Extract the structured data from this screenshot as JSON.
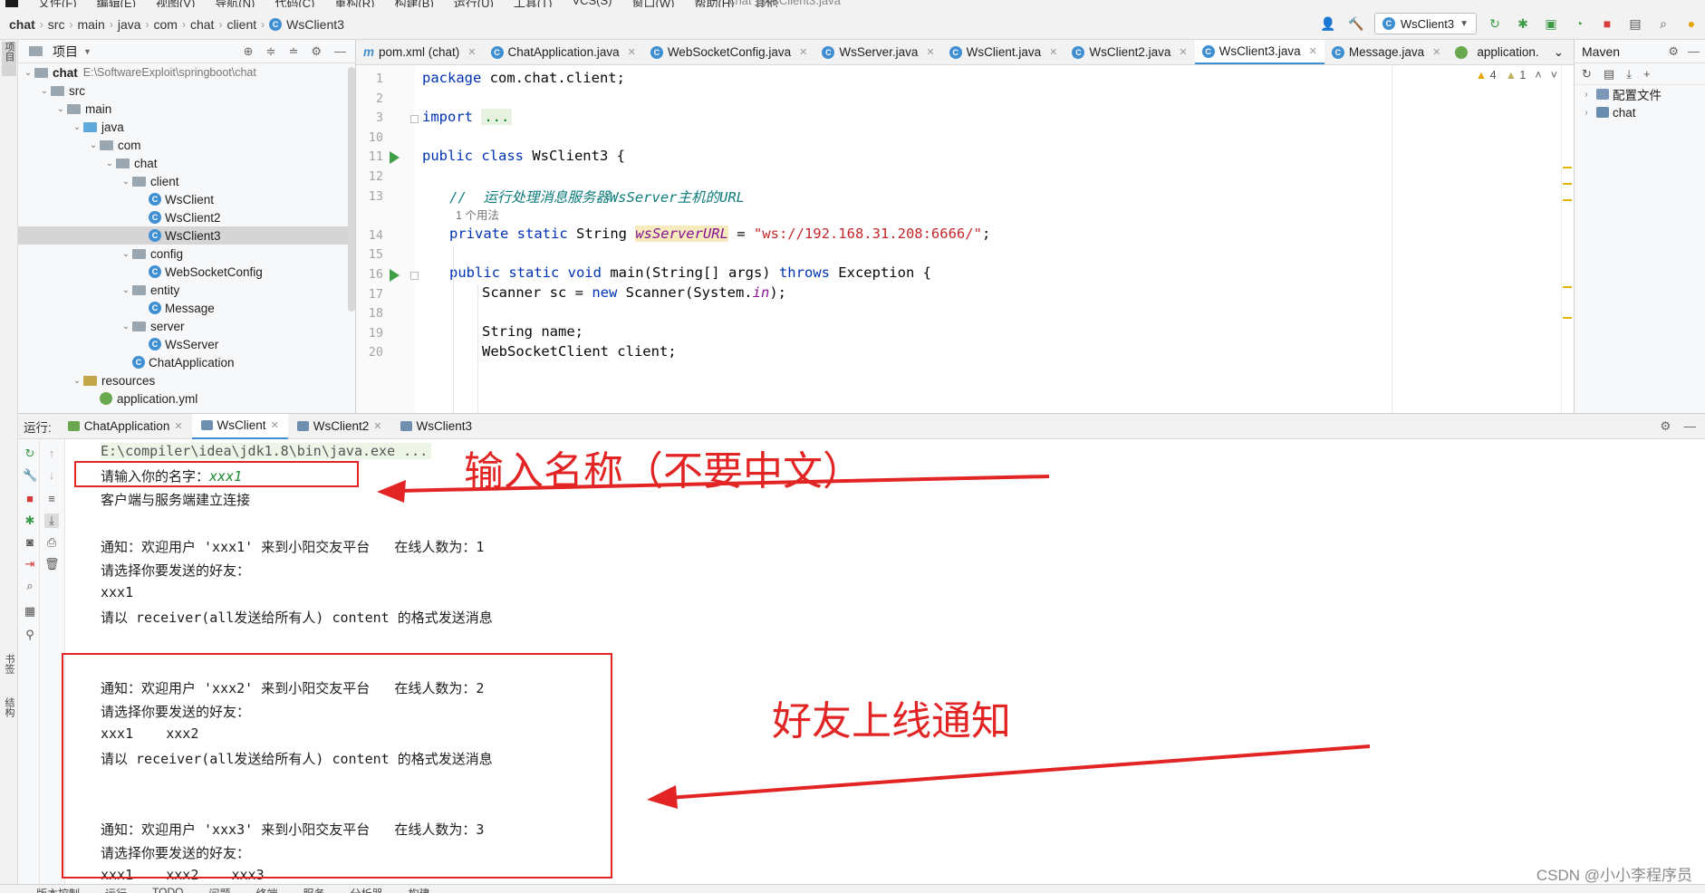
{
  "menubar": {
    "items": [
      "文件(F)",
      "编辑(E)",
      "视图(V)",
      "导航(N)",
      "代码(C)",
      "重构(R)",
      "构建(B)",
      "运行(U)",
      "工具(T)",
      "VCS(S)",
      "窗口(W)",
      "帮助(H)",
      "其他"
    ],
    "window_title": "chat - WsClient3.java"
  },
  "breadcrumb": [
    "chat",
    "src",
    "main",
    "java",
    "com",
    "chat",
    "client",
    "WsClient3"
  ],
  "toolbar": {
    "run_config": "WsClient3"
  },
  "left_strip": {
    "project_label": "项目",
    "bookmarks_label": "书签",
    "structure_label": "结构"
  },
  "project": {
    "title": "项目",
    "tree": [
      {
        "label": "chat",
        "extra": "E:\\SoftwareExploit\\springboot\\chat",
        "depth": 0,
        "type": "module",
        "open": true
      },
      {
        "label": "src",
        "depth": 1,
        "type": "folder",
        "open": true
      },
      {
        "label": "main",
        "depth": 2,
        "type": "folder",
        "open": true
      },
      {
        "label": "java",
        "depth": 3,
        "type": "folder-blue",
        "open": true
      },
      {
        "label": "com",
        "depth": 4,
        "type": "folder",
        "open": true
      },
      {
        "label": "chat",
        "depth": 5,
        "type": "folder",
        "open": true
      },
      {
        "label": "client",
        "depth": 6,
        "type": "folder",
        "open": true
      },
      {
        "label": "WsClient",
        "depth": 7,
        "type": "class"
      },
      {
        "label": "WsClient2",
        "depth": 7,
        "type": "class"
      },
      {
        "label": "WsClient3",
        "depth": 7,
        "type": "class",
        "selected": true
      },
      {
        "label": "config",
        "depth": 6,
        "type": "folder",
        "open": true
      },
      {
        "label": "WebSocketConfig",
        "depth": 7,
        "type": "class"
      },
      {
        "label": "entity",
        "depth": 6,
        "type": "folder",
        "open": true
      },
      {
        "label": "Message",
        "depth": 7,
        "type": "class"
      },
      {
        "label": "server",
        "depth": 6,
        "type": "folder",
        "open": true
      },
      {
        "label": "WsServer",
        "depth": 7,
        "type": "class"
      },
      {
        "label": "ChatApplication",
        "depth": 6,
        "type": "class"
      },
      {
        "label": "resources",
        "depth": 3,
        "type": "folder-res",
        "open": true
      },
      {
        "label": "application.yml",
        "depth": 4,
        "type": "yml"
      }
    ]
  },
  "editor": {
    "tabs": [
      {
        "label": "pom.xml (chat)",
        "icon": "m"
      },
      {
        "label": "ChatApplication.java",
        "icon": "c"
      },
      {
        "label": "WebSocketConfig.java",
        "icon": "c"
      },
      {
        "label": "WsServer.java",
        "icon": "c"
      },
      {
        "label": "WsClient.java",
        "icon": "c"
      },
      {
        "label": "WsClient2.java",
        "icon": "c"
      },
      {
        "label": "WsClient3.java",
        "icon": "c",
        "active": true
      },
      {
        "label": "Message.java",
        "icon": "c"
      },
      {
        "label": "application.",
        "icon": "yml"
      }
    ],
    "inspections": {
      "warnings": "4",
      "weak_warnings": "1"
    },
    "line_numbers": [
      "1",
      "2",
      "3",
      "10",
      "11",
      "12",
      "13",
      "",
      "14",
      "15",
      "16",
      "17",
      "18",
      "19",
      "20"
    ],
    "code": {
      "l1_kw": "package",
      "l1_rest": " com.chat.client;",
      "l3_kw": "import",
      "l3_fold": "...",
      "l11_kw": "public class",
      "l11_rest": " WsClient3 {",
      "l13_comment": "//  运行处理消息服务器WsServer主机的URL",
      "usage": "1 个用法",
      "l14_kw": "private static",
      "l14_type": " String ",
      "l14_field": "wsServerURL",
      "l14_eq": " = ",
      "l14_str": "\"ws://192.168.31.208:6666/\"",
      "l14_end": ";",
      "l16_kw": "public static void",
      "l16_mid": " main(String[] args) ",
      "l16_kw2": "throws",
      "l16_end": " Exception {",
      "l17_a": "Scanner sc = ",
      "l17_kw": "new",
      "l17_b": " Scanner(System.",
      "l17_in": "in",
      "l17_c": ");",
      "l19": "String name;",
      "l20": "WebSocketClient client;"
    }
  },
  "maven": {
    "title": "Maven",
    "items": [
      "配置文件",
      "chat"
    ]
  },
  "run_panel": {
    "label": "运行:",
    "tabs": [
      "ChatApplication",
      "WsClient",
      "WsClient2",
      "WsClient3"
    ],
    "active_tab": "WsClient",
    "console": {
      "cmd": "E:\\compiler\\idea\\jdk1.8\\bin\\java.exe ...",
      "prompt": "请输入你的名字：",
      "input": "xxx1",
      "connected": "客户端与服务端建立连接",
      "n1": "通知：欢迎用户 'xxx1' 来到小阳交友平台   在线人数为：1",
      "choose1": "请选择你要发送的好友：",
      "friends1": "xxx1",
      "format1": "请以 receiver(all发送给所有人) content 的格式发送消息",
      "n2": "通知：欢迎用户 'xxx2' 来到小阳交友平台   在线人数为：2",
      "choose2": "请选择你要发送的好友：",
      "friends2": "xxx1    xxx2",
      "format2": "请以 receiver(all发送给所有人) content 的格式发送消息",
      "n3": "通知：欢迎用户 'xxx3' 来到小阳交友平台   在线人数为：3",
      "choose3": "请选择你要发送的好友：",
      "friends3": "xxx1    xxx2    xxx3"
    }
  },
  "annotations": {
    "name_hint": "输入名称（不要中文）",
    "online_notice": "好友上线通知",
    "color": "#e22424"
  },
  "bottom_bar": [
    "版本控制",
    "运行",
    "TODO",
    "问题",
    "终端",
    "服务",
    "分析器",
    "构建"
  ],
  "watermark": "CSDN @小小李程序员"
}
